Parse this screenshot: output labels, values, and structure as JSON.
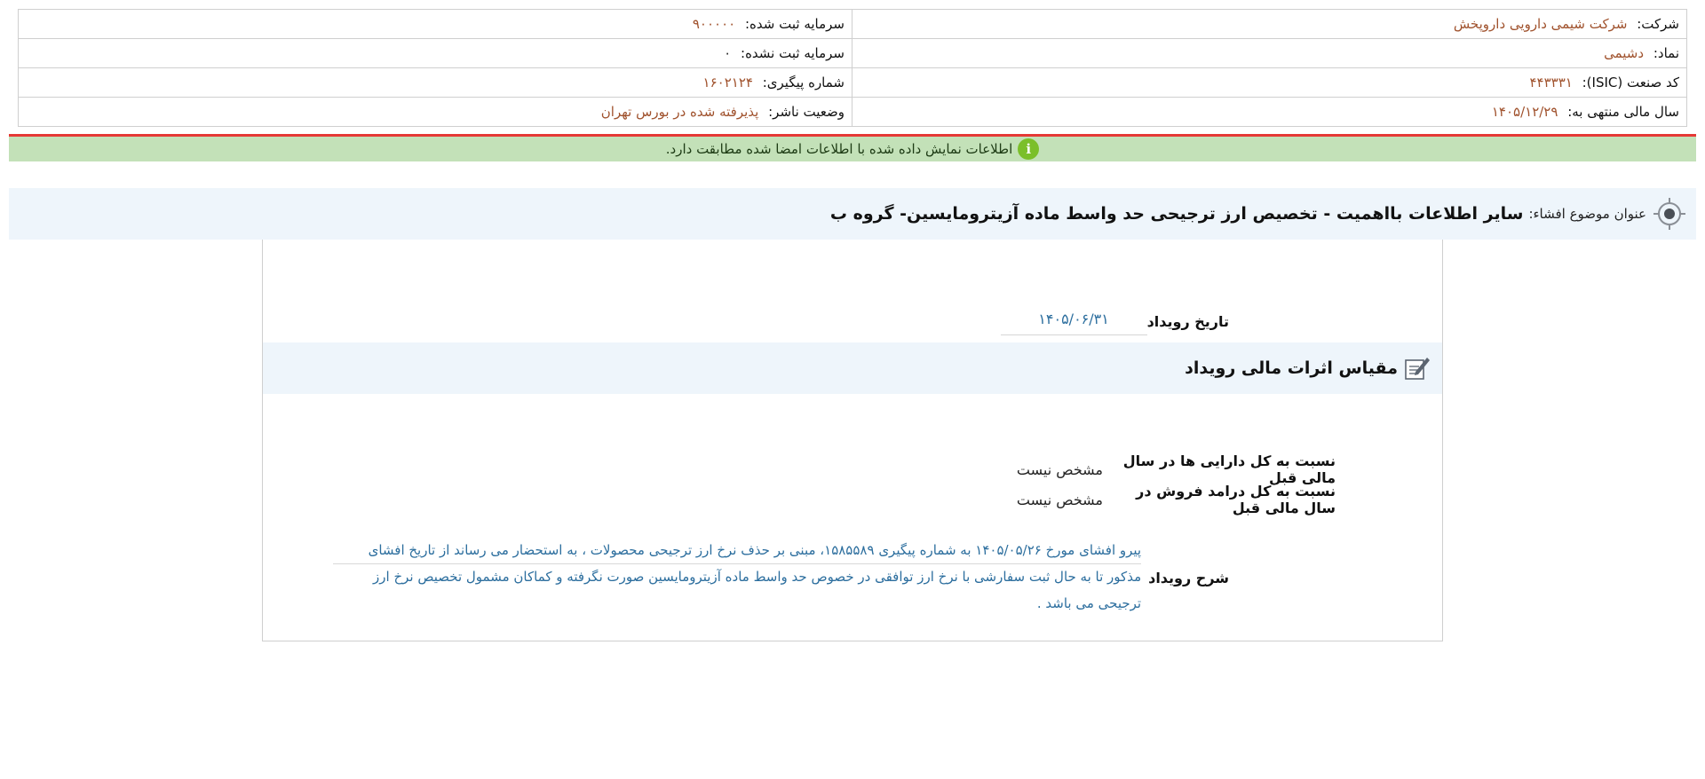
{
  "company_info": {
    "company_label": "شرکت:",
    "company_value": "شرکت شیمی دارویی داروپخش",
    "symbol_label": "نماد:",
    "symbol_value": "دشیمی",
    "isic_label": "کد صنعت (ISIC):",
    "isic_value": "۴۴۳۳۳۱",
    "fiscal_year_label": "سال مالی منتهی به:",
    "fiscal_year_value": "۱۴۰۵/۱۲/۲۹",
    "registered_capital_label": "سرمایه ثبت شده:",
    "registered_capital_value": "۹۰۰۰۰۰",
    "unregistered_capital_label": "سرمایه ثبت نشده:",
    "unregistered_capital_value": "۰",
    "tracking_label": "شماره پیگیری:",
    "tracking_value": "۱۶۰۲۱۲۴",
    "publisher_status_label": "وضعیت ناشر:",
    "publisher_status_value": "پذیرفته شده در بورس تهران"
  },
  "verification": {
    "icon": "info-icon",
    "message": "اطلاعات نمایش داده شده با اطلاعات امضا شده مطابقت دارد.",
    "accent_color": "#e53935",
    "background_color": "#c3e1b8"
  },
  "subject": {
    "icon": "target-icon",
    "label": "عنوان موضوع افشاء:",
    "title": "سایر اطلاعات بااهمیت - تخصیص ارز ترجیحی حد واسط ماده آزیترومایسین- گروه ب"
  },
  "event": {
    "date_label": "تاریخ رویداد",
    "date_value": "۱۴۰۵/۰۶/۳۱",
    "financial_section_icon": "edit-icon",
    "financial_section_title": "مقیاس اثرات مالی رویداد",
    "ratio_assets_label": "نسبت به کل دارایی ها در سال مالی قبل",
    "ratio_assets_value": "مشخص نیست",
    "ratio_sales_label": "نسبت به کل درامد فروش در سال مالی قبل",
    "ratio_sales_value": "مشخص نیست",
    "description_label": "شرح رویداد",
    "description_text": "پیرو افشای مورخ ۱۴۰۵/۰۵/۲۶ به شماره پیگیری ۱۵۸۵۵۸۹، مبنی بر حذف نرخ ارز ترجیحی محصولات ، به استحضار می رساند از تاریخ افشای مذکور تا به حال ثبت سفارشی با نرخ ارز توافقی در خصوص حد واسط ماده آزیترومایسین صورت نگرفته و کماکان مشمول تخصیص نرخ ارز ترجیحی می باشد ."
  }
}
